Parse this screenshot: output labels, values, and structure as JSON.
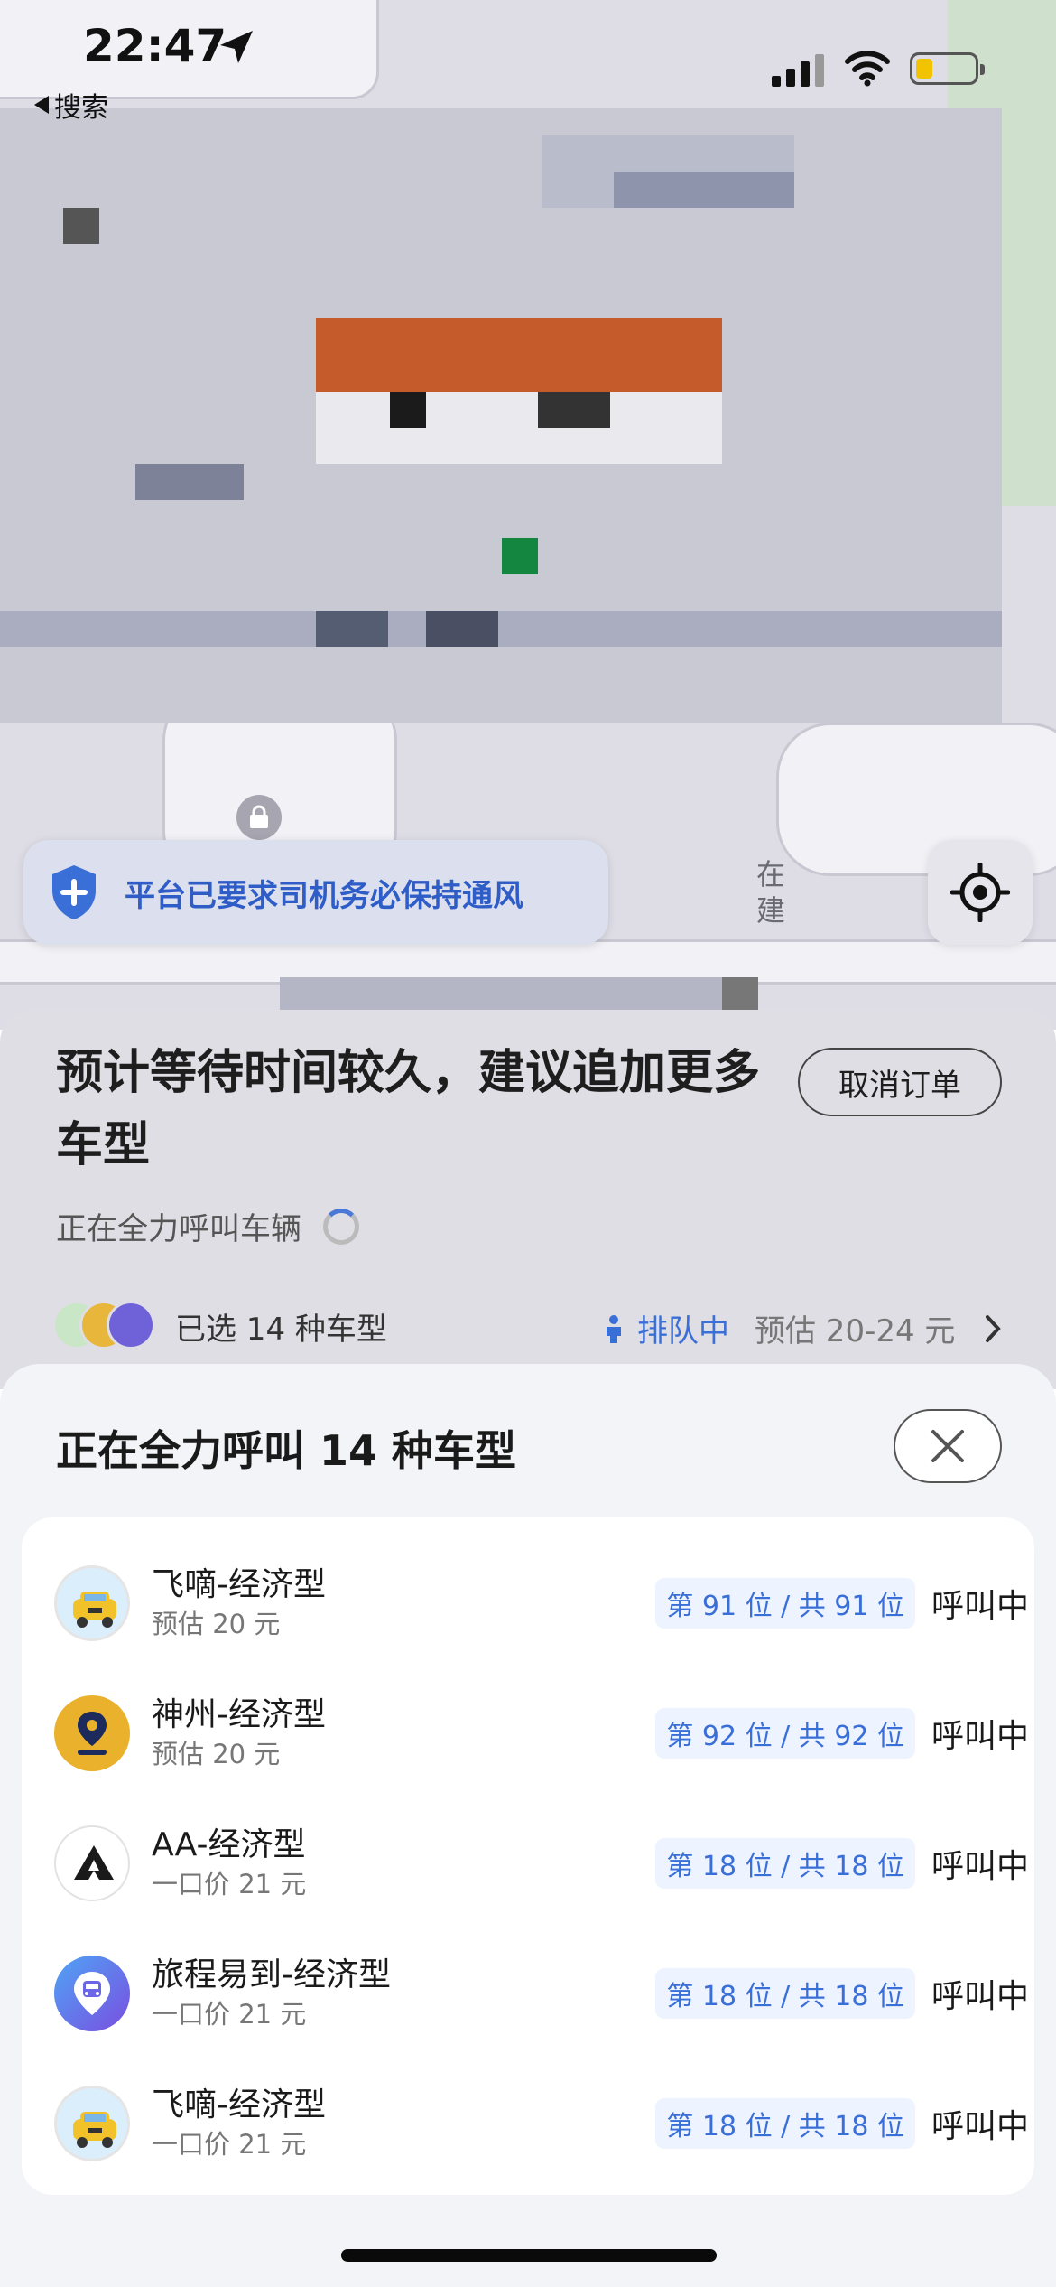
{
  "status_bar": {
    "time": "22:47",
    "back_label": "搜索"
  },
  "map": {
    "notice_text": "平台已要求司机务必保持通风",
    "road_label_1": "在",
    "road_label_2": "建"
  },
  "order": {
    "title": "预计等待时间较久，建议追加更多车型",
    "cancel_label": "取消订单",
    "calling_text": "正在全力呼叫车辆",
    "selected_text": "已选 14 种车型",
    "queue_text": "排队中",
    "estimate_text": "预估 20-24 元"
  },
  "sheet": {
    "title": "正在全力呼叫 14 种车型",
    "items": [
      {
        "name": "飞嘀-经济型",
        "price": "预估 20 元",
        "rank": "第 91 位 / 共 91 位",
        "status": "呼叫中",
        "logo": "taxi-logo"
      },
      {
        "name": "神州-经济型",
        "price": "预估 20 元",
        "rank": "第 92 位 / 共 92 位",
        "status": "呼叫中",
        "logo": "shenzhou-logo"
      },
      {
        "name": "AA-经济型",
        "price": "一口价 21 元",
        "rank": "第 18 位 / 共 18 位",
        "status": "呼叫中",
        "logo": "aa-logo"
      },
      {
        "name": "旅程易到-经济型",
        "price": "一口价 21 元",
        "rank": "第 18 位 / 共 18 位",
        "status": "呼叫中",
        "logo": "lvcheng-logo"
      },
      {
        "name": "飞嘀-经济型",
        "price": "一口价 21 元",
        "rank": "第 18 位 / 共 18 位",
        "status": "呼叫中",
        "logo": "taxi-logo"
      }
    ]
  },
  "colors": {
    "accent_blue": "#3a6fd8",
    "battery_yellow": "#f2c300"
  }
}
